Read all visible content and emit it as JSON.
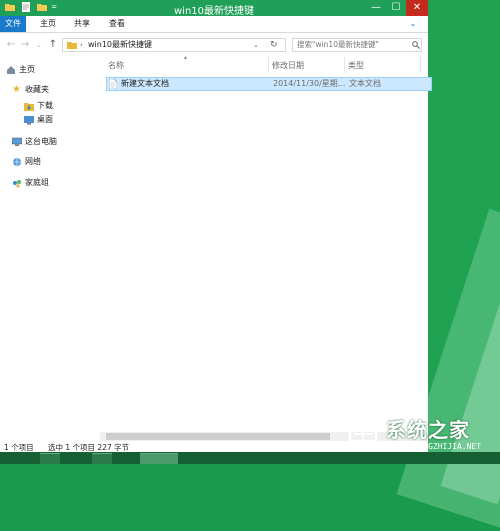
{
  "window": {
    "title": "win10最新快捷键",
    "controls": {
      "minimize": "—",
      "maximize": "☐",
      "close": "✕"
    }
  },
  "ribbon": {
    "tabs": [
      "文件",
      "主页",
      "共享",
      "查看"
    ]
  },
  "address": {
    "path": "win10最新快捷键",
    "search_placeholder": "搜索\"win10最新快捷键\""
  },
  "nav_pane": {
    "items": [
      {
        "label": "主页",
        "icon": "home-icon"
      },
      {
        "label": "收藏夹",
        "icon": "star-icon"
      },
      {
        "label": "下载",
        "icon": "download-folder-icon"
      },
      {
        "label": "桌面",
        "icon": "desktop-icon"
      },
      {
        "label": "这台电脑",
        "icon": "computer-icon"
      },
      {
        "label": "网络",
        "icon": "network-icon"
      },
      {
        "label": "家庭组",
        "icon": "homegroup-icon"
      }
    ]
  },
  "file_list": {
    "columns": [
      "名称",
      "修改日期",
      "类型"
    ],
    "rows": [
      {
        "name": "新建文本文档",
        "modified": "2014/11/30/星期...",
        "type": "文本文档"
      }
    ]
  },
  "status": {
    "items_count": "1 个项目",
    "selection": "选中 1 个项目  227 字节"
  },
  "watermark": {
    "text": "系统之家",
    "url": "XITONGZHIJIA.NET"
  },
  "colors": {
    "titlebar": "#1f9f57",
    "file_tab": "#1979ca",
    "selection": "#cce8ff",
    "desktop": "#1c9d4f"
  }
}
